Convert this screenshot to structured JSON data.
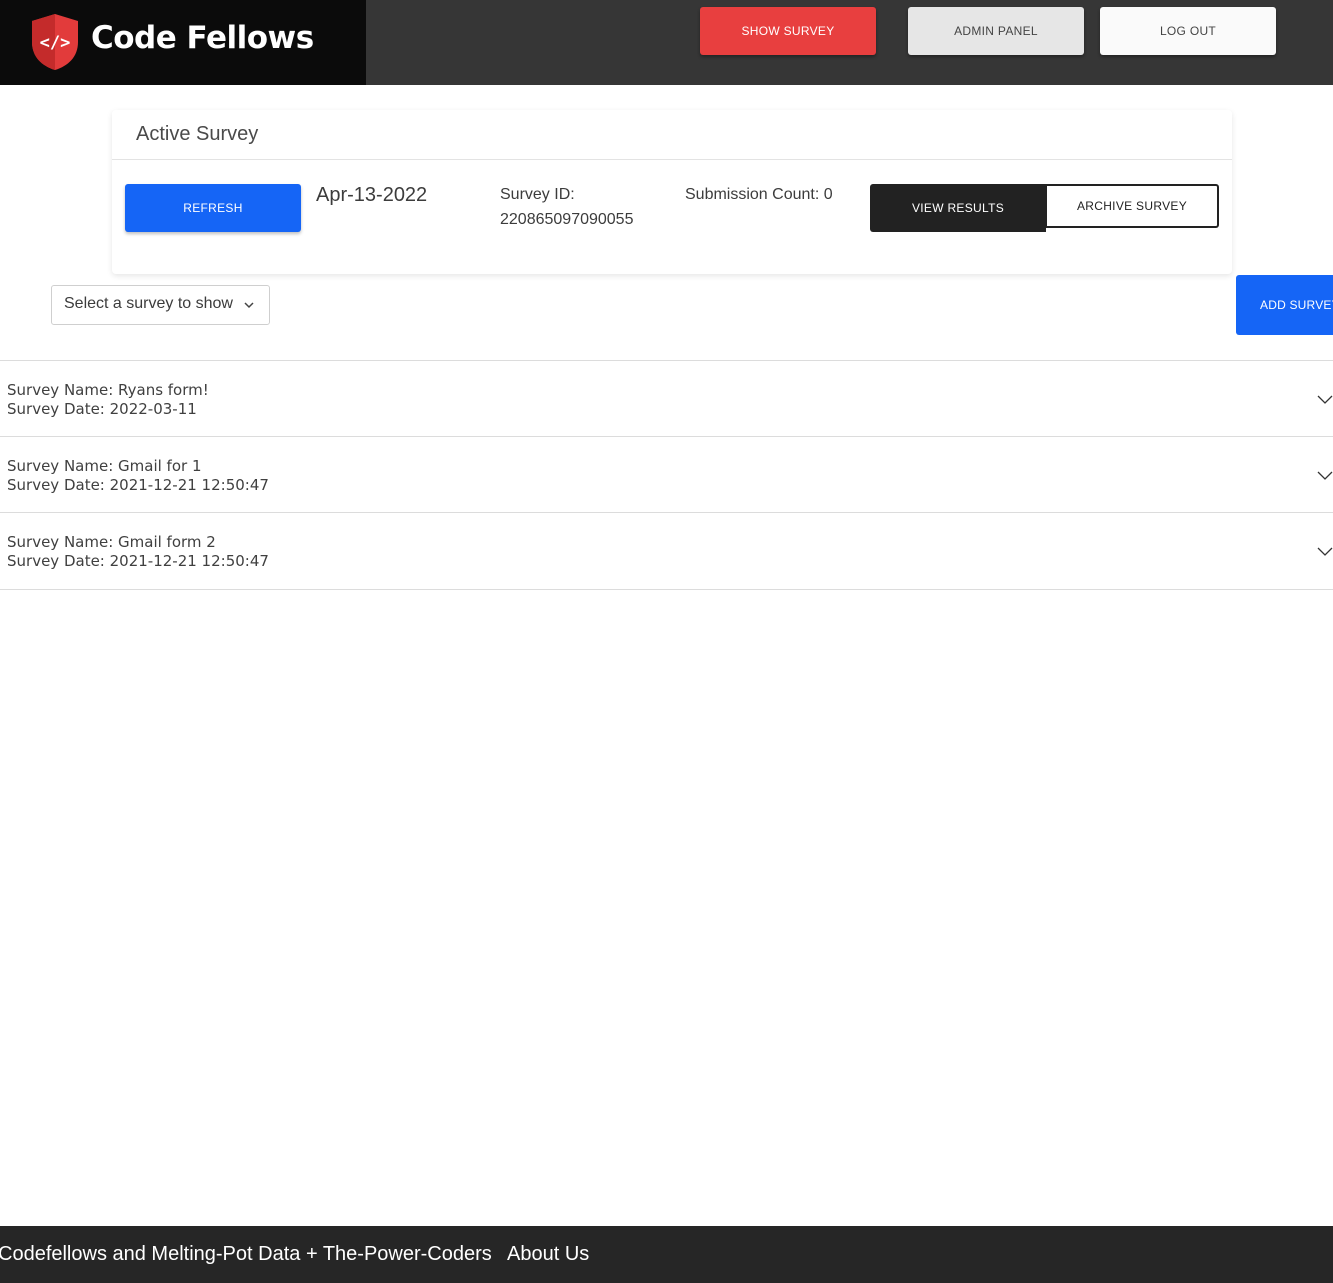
{
  "header": {
    "logo_text": "Code Fellows",
    "show_survey_label": "SHOW SURVEY",
    "admin_panel_label": "ADMIN PANEL",
    "log_out_label": "LOG OUT"
  },
  "active_survey": {
    "title": "Active Survey",
    "refresh_label": "REFRESH",
    "date": "Apr-13-2022",
    "survey_id_label": "Survey ID:",
    "survey_id_value": "220865097090055",
    "submission_count": "Submission Count: 0",
    "view_results_label": "VIEW RESULTS",
    "archive_label": "ARCHIVE SURVEY"
  },
  "controls": {
    "select_label": "Select a survey to show",
    "add_survey_label": "ADD SURVEY"
  },
  "surveys": [
    {
      "name": "Survey Name: Ryans form!",
      "date": "Survey Date: 2022-03-11"
    },
    {
      "name": "Survey Name: Gmail for 1",
      "date": "Survey Date: 2021-12-21 12:50:47"
    },
    {
      "name": "Survey Name: Gmail form 2",
      "date": "Survey Date: 2021-12-21 12:50:47"
    }
  ],
  "footer": {
    "credits": "Codefellows and Melting-Pot Data + The-Power-Coders",
    "about_link": "About Us"
  },
  "colors": {
    "header_bg": "#363636",
    "logo_bg": "#0b0b0b",
    "show_survey_red": "#e83f3f",
    "primary_blue": "#1565f6",
    "dark_button": "#222222",
    "footer_bg": "#262626"
  },
  "icons": {
    "logo": "code-shield-icon",
    "select_chevron": "chevron-down-icon",
    "row_chevron": "chevron-down-icon"
  }
}
